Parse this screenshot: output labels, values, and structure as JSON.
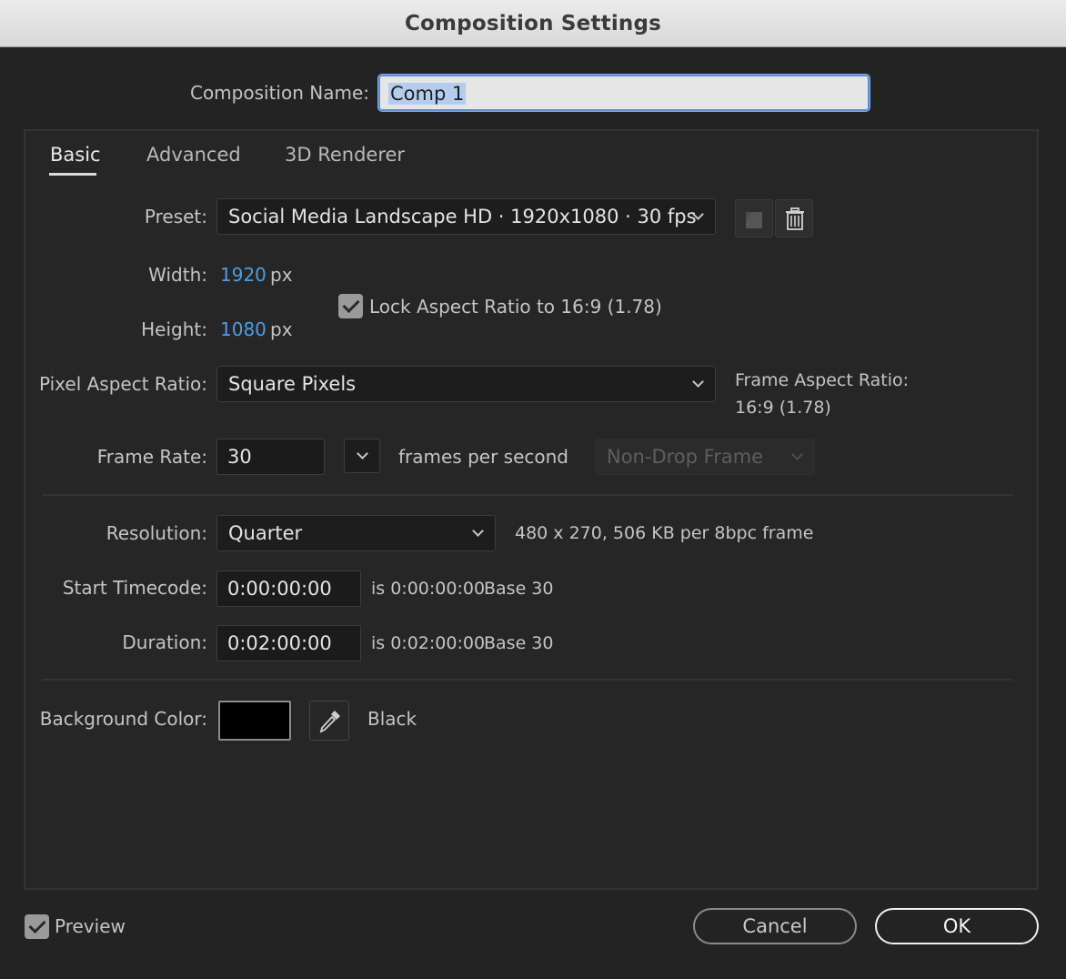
{
  "window": {
    "title": "Composition Settings"
  },
  "comp_name": {
    "label": "Composition Name:",
    "value": "Comp 1"
  },
  "tabs": [
    {
      "label": "Basic",
      "active": true
    },
    {
      "label": "Advanced",
      "active": false
    },
    {
      "label": "3D Renderer",
      "active": false
    }
  ],
  "preset": {
    "label": "Preset:",
    "value": "Social Media Landscape HD  ·  1920x1080 · 30 fps",
    "save_icon": "save-preset-icon",
    "delete_icon": "trash-icon"
  },
  "width": {
    "label": "Width:",
    "value": "1920",
    "unit": "px"
  },
  "height": {
    "label": "Height:",
    "value": "1080",
    "unit": "px"
  },
  "lock_aspect": {
    "label": "Lock Aspect Ratio to 16:9 (1.78)",
    "checked": true
  },
  "pixel_aspect": {
    "label": "Pixel Aspect Ratio:",
    "value": "Square Pixels"
  },
  "frame_aspect": {
    "label": "Frame Aspect Ratio:",
    "value": "16:9 (1.78)"
  },
  "frame_rate": {
    "label": "Frame Rate:",
    "value": "30",
    "unit_label": "frames per second",
    "drop_frame": "Non-Drop Frame"
  },
  "resolution": {
    "label": "Resolution:",
    "value": "Quarter",
    "info": "480 x 270, 506 KB per 8bpc frame"
  },
  "start_timecode": {
    "label": "Start Timecode:",
    "value": "0:00:00:00",
    "is": "is 0:00:00:00",
    "base": "Base 30"
  },
  "duration": {
    "label": "Duration:",
    "value": "0:02:00:00",
    "is": "is 0:02:00:00",
    "base": "Base 30"
  },
  "background": {
    "label": "Background Color:",
    "swatch": "#000000",
    "name": "Black",
    "eyedropper_icon": "eyedropper-icon"
  },
  "footer": {
    "preview_label": "Preview",
    "preview_checked": true,
    "cancel_label": "Cancel",
    "ok_label": "OK"
  },
  "colors": {
    "accent_blue": "#4a9ee6",
    "title_bar": "#e0e0e0",
    "dialog_bg": "#232323"
  }
}
